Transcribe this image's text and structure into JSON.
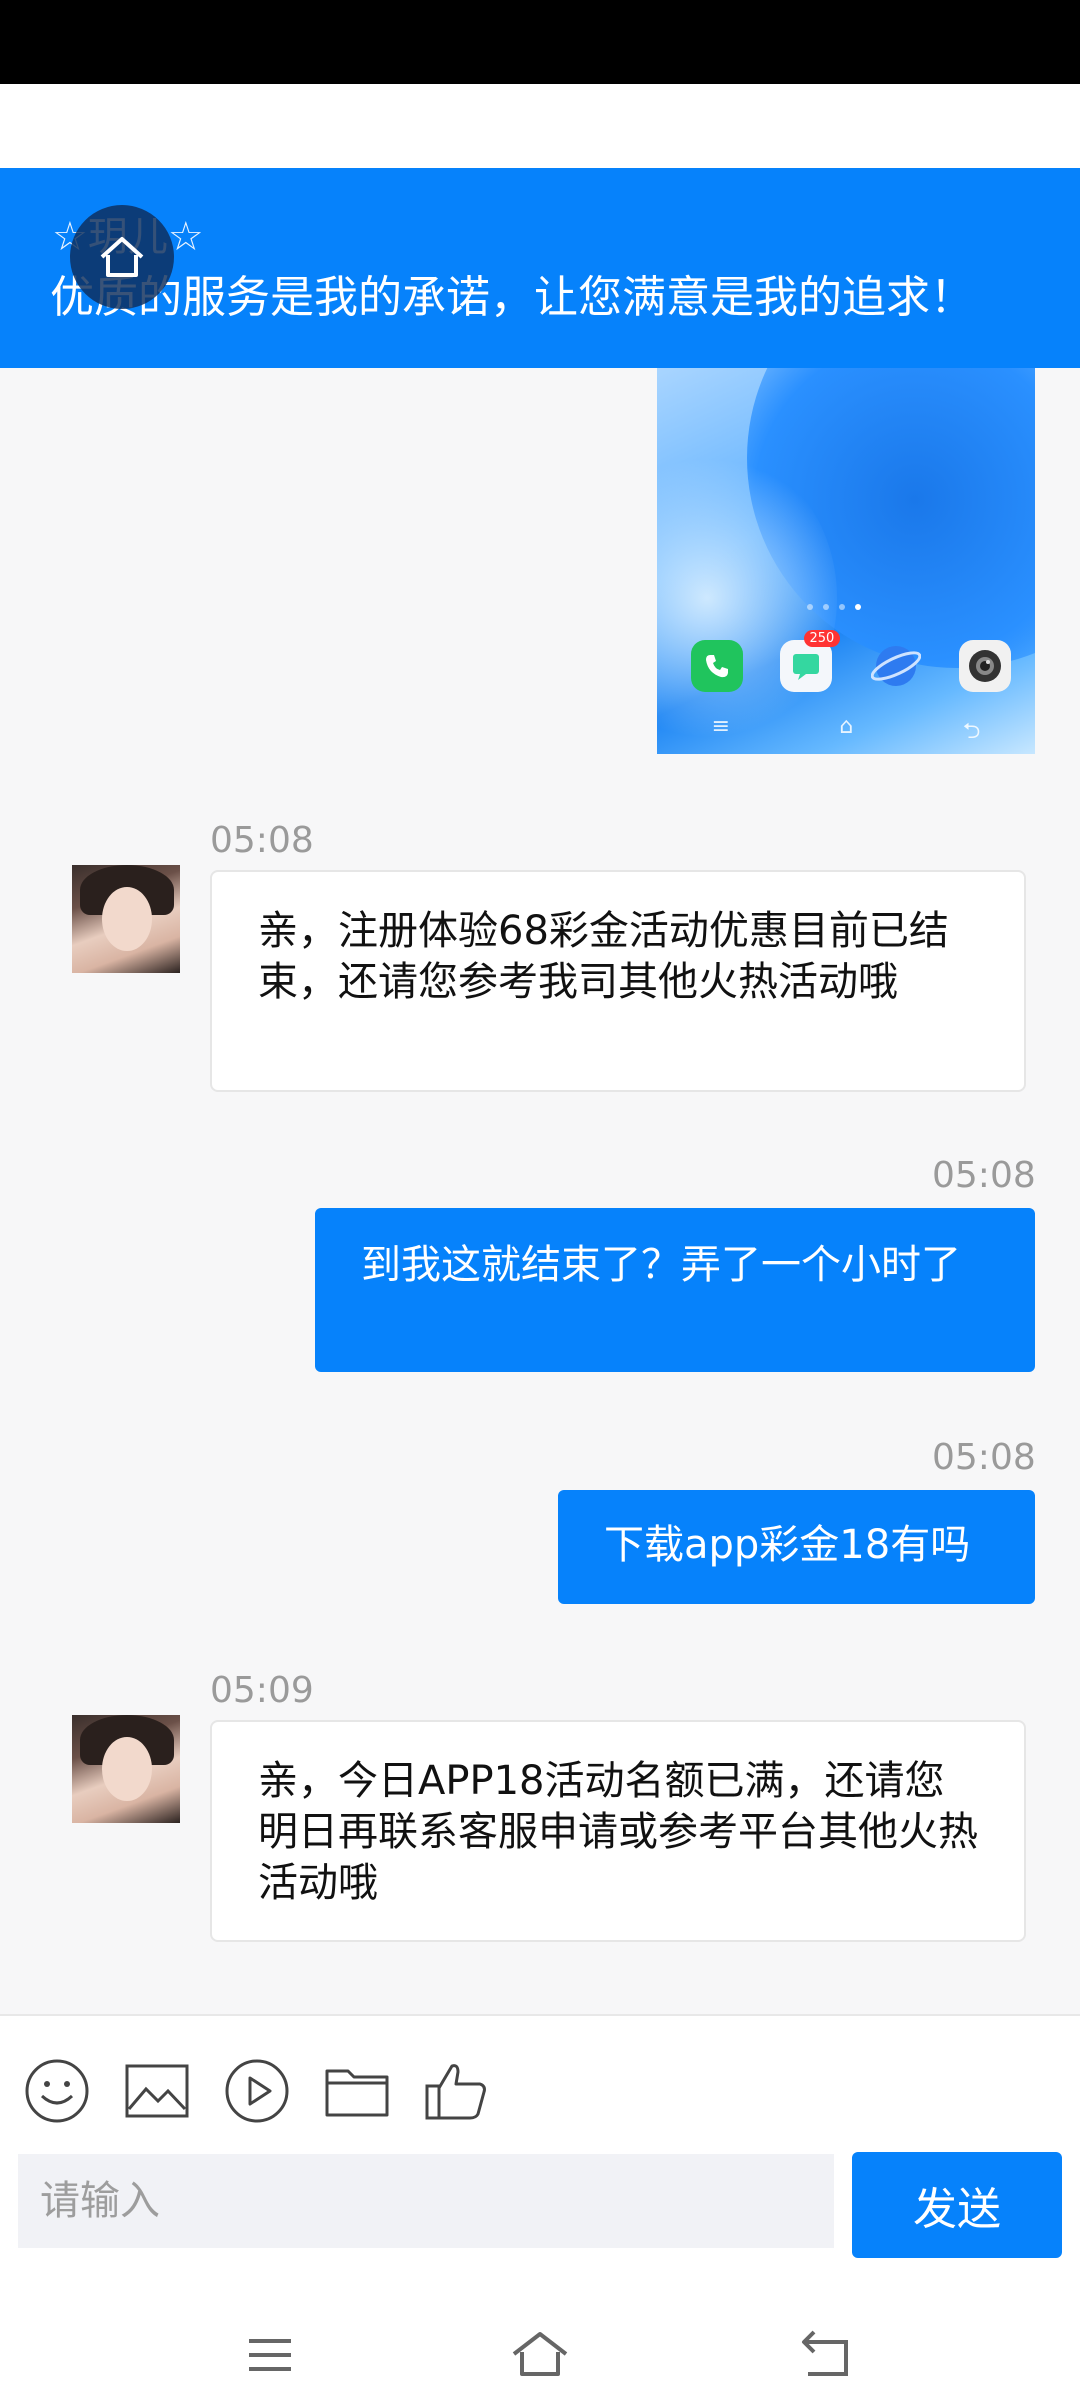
{
  "header": {
    "agent_name": "☆玥儿☆",
    "slogan": "优质的服务是我的承诺，让您满意是我的追求！"
  },
  "shared_screenshot": {
    "badge_count": "250"
  },
  "messages": [
    {
      "direction": "in",
      "time": "05:08",
      "text": "亲，注册体验68彩金活动优惠目前已结束，还请您参考我司其他火热活动哦"
    },
    {
      "direction": "out",
      "time": "05:08",
      "text": "到我这就结束了？弄了一个小时了"
    },
    {
      "direction": "out",
      "time": "05:08",
      "text": "下载app彩金18有吗"
    },
    {
      "direction": "in",
      "time": "05:09",
      "text": "亲，今日APP18活动名额已满，还请您明日再联系客服申请或参考平台其他火热活动哦"
    }
  ],
  "composer": {
    "placeholder": "请输入",
    "send_label": "发送"
  },
  "toolbar_icons": [
    "emoji-icon",
    "image-icon",
    "video-icon",
    "folder-icon",
    "thumbs-up-icon"
  ],
  "colors": {
    "accent": "#0682fb",
    "background": "#f7f7f8"
  }
}
